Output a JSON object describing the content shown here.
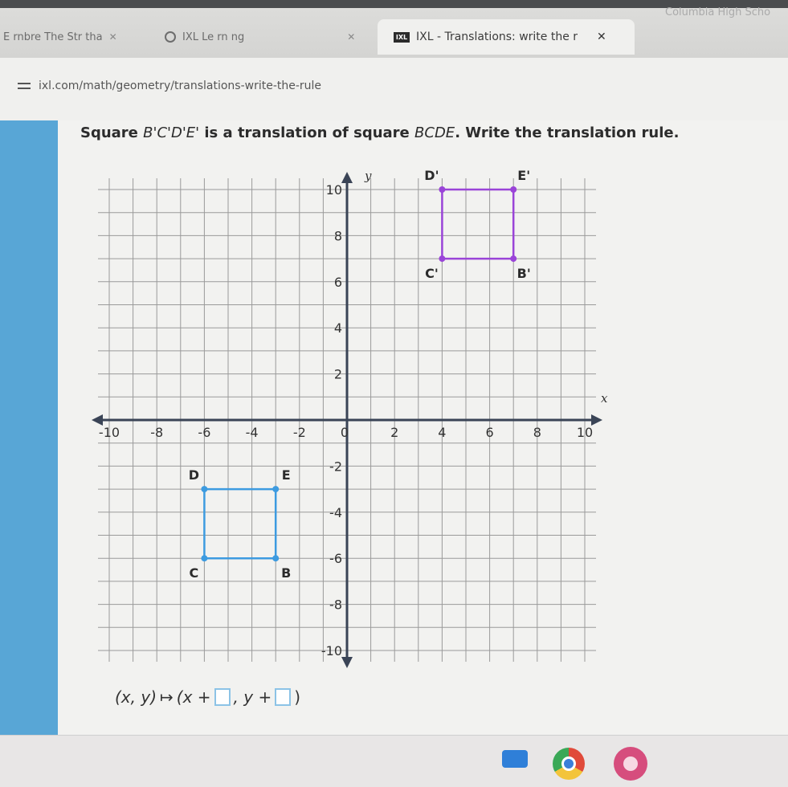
{
  "browser": {
    "tabs": [
      {
        "title": "E rnbre The Str tha"
      },
      {
        "title": "IXL Le rn ng"
      },
      {
        "title": "IXL - Translations: write the r"
      }
    ],
    "profile_hint": "Columbia High Scho",
    "url": "ixl.com/math/geometry/translations-write-the-rule"
  },
  "question": {
    "prefix": "Square ",
    "image_name": "B'C'D'E'",
    "middle": " is a translation of square ",
    "pre_image_name": "BCDE",
    "suffix": ". Write the translation rule."
  },
  "chart_data": {
    "type": "scatter",
    "xlim": [
      -10,
      10
    ],
    "ylim": [
      -10,
      10
    ],
    "grid": true,
    "xlabel": "x",
    "ylabel": "y",
    "x_ticks": [
      -10,
      -8,
      -6,
      -4,
      -2,
      0,
      2,
      4,
      6,
      8,
      10
    ],
    "y_ticks": [
      10,
      8,
      6,
      4,
      2,
      -2,
      -4,
      -6,
      -8,
      -10
    ],
    "series": [
      {
        "name": "BCDE",
        "color": "#3d9be0",
        "points": [
          {
            "label": "B",
            "x": -3,
            "y": -6
          },
          {
            "label": "C",
            "x": -6,
            "y": -6
          },
          {
            "label": "D",
            "x": -6,
            "y": -3
          },
          {
            "label": "E",
            "x": -3,
            "y": -3
          }
        ]
      },
      {
        "name": "B'C'D'E'",
        "color": "#9a44d8",
        "points": [
          {
            "label": "B'",
            "x": 7,
            "y": 7
          },
          {
            "label": "C'",
            "x": 4,
            "y": 7
          },
          {
            "label": "D'",
            "x": 4,
            "y": 10
          },
          {
            "label": "E'",
            "x": 7,
            "y": 10
          }
        ]
      }
    ]
  },
  "answer": {
    "lhs": "(x, y)",
    "arrow": "↦",
    "open": "(x +",
    "mid": ", y +",
    "close": ")"
  },
  "taskbar": {
    "icons": [
      "files-icon",
      "chrome-icon",
      "app-icon"
    ]
  }
}
